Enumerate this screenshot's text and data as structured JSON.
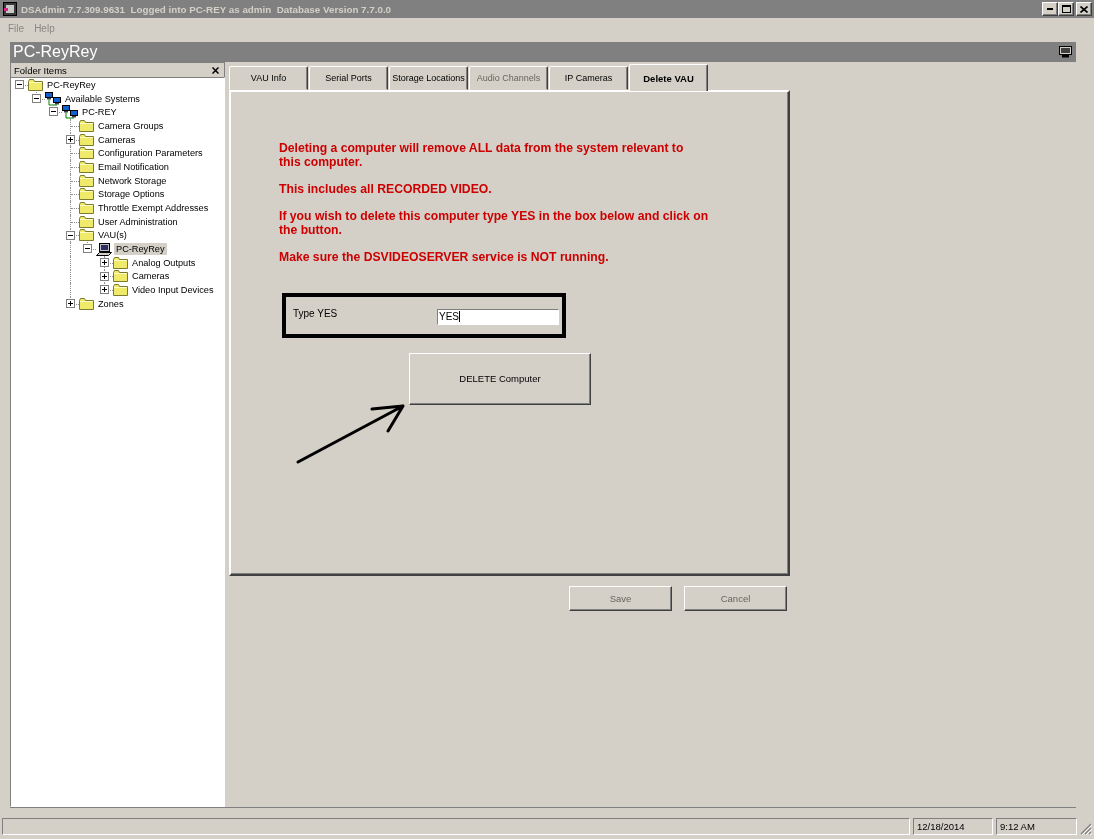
{
  "window": {
    "title": "DSAdmin 7.7.309.9631  Logged into PC-REY as admin  Database Version 7.7.0.0"
  },
  "menu": [
    {
      "label": "File",
      "disabled": true
    },
    {
      "label": "Help",
      "disabled": true
    }
  ],
  "header": {
    "title": "PC-ReyRey"
  },
  "folder_panel": {
    "title": "Folder Items",
    "tree": [
      {
        "label": "PC-ReyRey",
        "kind": "folder",
        "selected": false,
        "expanded": true,
        "children": [
          {
            "label": "Available Systems",
            "kind": "system",
            "selected": false,
            "expanded": true,
            "children": [
              {
                "label": "PC-REY",
                "kind": "system",
                "selected": false,
                "expanded": true,
                "children": [
                  {
                    "label": "Camera Groups",
                    "kind": "folder",
                    "selected": false
                  },
                  {
                    "label": "Cameras",
                    "kind": "folder",
                    "selected": false,
                    "expanded": false
                  },
                  {
                    "label": "Configuration Parameters",
                    "kind": "folder",
                    "selected": false
                  },
                  {
                    "label": "Email Notification",
                    "kind": "folder",
                    "selected": false
                  },
                  {
                    "label": "Network Storage",
                    "kind": "folder",
                    "selected": false
                  },
                  {
                    "label": "Storage Options",
                    "kind": "folder",
                    "selected": false
                  },
                  {
                    "label": "Throttle Exempt Addresses",
                    "kind": "folder",
                    "selected": false
                  },
                  {
                    "label": "User Administration",
                    "kind": "folder",
                    "selected": false
                  },
                  {
                    "label": "VAU(s)",
                    "kind": "folder",
                    "selected": false,
                    "expanded": true,
                    "children": [
                      {
                        "label": "PC-ReyRey",
                        "kind": "computer",
                        "selected": true,
                        "expanded": true,
                        "children": [
                          {
                            "label": "Analog Outputs",
                            "kind": "folder",
                            "selected": false,
                            "expanded": false
                          },
                          {
                            "label": "Cameras",
                            "kind": "folder",
                            "selected": false,
                            "expanded": false
                          },
                          {
                            "label": "Video Input Devices",
                            "kind": "folder",
                            "selected": false,
                            "expanded": false
                          }
                        ]
                      }
                    ]
                  },
                  {
                    "label": "Zones",
                    "kind": "folder",
                    "selected": false,
                    "expanded": false
                  }
                ]
              }
            ]
          }
        ]
      }
    ]
  },
  "tabs": [
    {
      "label": "VAU Info",
      "selected": false,
      "disabled": false
    },
    {
      "label": "Serial Ports",
      "selected": false,
      "disabled": false
    },
    {
      "label": "Storage Locations",
      "selected": false,
      "disabled": false
    },
    {
      "label": "Audio Channels",
      "selected": false,
      "disabled": true
    },
    {
      "label": "IP Cameras",
      "selected": false,
      "disabled": false
    },
    {
      "label": "Delete VAU",
      "selected": true,
      "disabled": false
    }
  ],
  "delete_vau": {
    "warnings": [
      "Deleting a computer will remove ALL data from the system relevant to\nthis computer.",
      "This includes all RECORDED VIDEO.",
      "If you wish to delete this computer type YES in the box below and click on\nthe button.",
      "Make sure the DSVIDEOSERVER service is NOT running."
    ],
    "confirm": {
      "label": "Type YES",
      "value": "YES"
    },
    "delete_button": "DELETE Computer"
  },
  "buttons": [
    {
      "label": "Save",
      "disabled": true
    },
    {
      "label": "Cancel",
      "disabled": true
    }
  ],
  "status_bar": {
    "date": "12/18/2014",
    "time": "9:12 AM"
  }
}
